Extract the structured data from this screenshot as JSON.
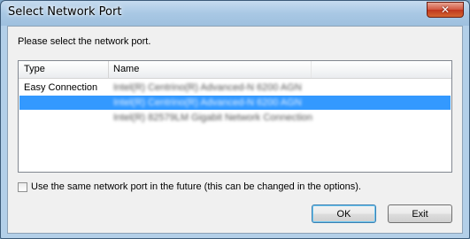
{
  "window": {
    "title": "Select Network Port",
    "close_glyph": "✕"
  },
  "dialog": {
    "prompt": "Please select the network port."
  },
  "list": {
    "columns": [
      "Type",
      "Name"
    ],
    "rows": [
      {
        "type": "Easy Connection",
        "name": "Intel(R) Centrino(R) Advanced-N 6200 AGN",
        "selected": false
      },
      {
        "type": "",
        "name": "Intel(R) Centrino(R) Advanced-N 6200 AGN",
        "selected": true
      },
      {
        "type": "",
        "name": "Intel(R) 82579LM Gigabit Network Connection",
        "selected": false
      }
    ]
  },
  "options": {
    "same_port_label": "Use the same network port in the future (this can be changed in the options).",
    "same_port_checked": false
  },
  "buttons": {
    "ok": "OK",
    "exit": "Exit"
  },
  "colors": {
    "selection": "#3399ff",
    "title_bar": "#a9c8e4"
  }
}
